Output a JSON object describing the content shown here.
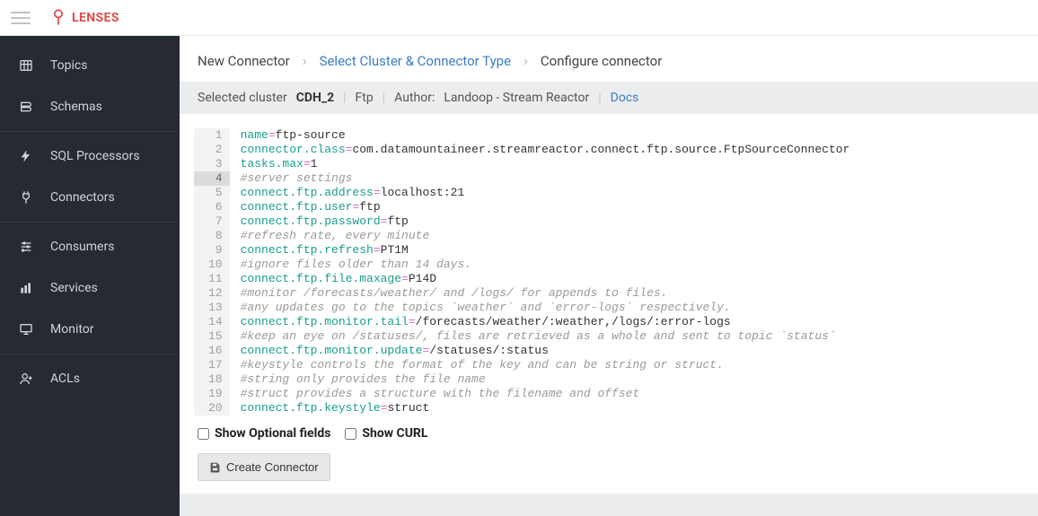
{
  "brand": {
    "name": "LENSES"
  },
  "sidebar": {
    "groups": [
      {
        "items": [
          {
            "icon": "table-icon",
            "label": "Topics"
          },
          {
            "icon": "layers-icon",
            "label": "Schemas"
          }
        ]
      },
      {
        "items": [
          {
            "icon": "bolt-icon",
            "label": "SQL Processors"
          },
          {
            "icon": "plug-icon",
            "label": "Connectors"
          }
        ]
      },
      {
        "items": [
          {
            "icon": "sliders-icon",
            "label": "Consumers"
          },
          {
            "icon": "barchart-icon",
            "label": "Services"
          },
          {
            "icon": "monitor-icon",
            "label": "Monitor"
          }
        ]
      },
      {
        "items": [
          {
            "icon": "useradd-icon",
            "label": "ACLs"
          }
        ]
      }
    ]
  },
  "breadcrumbs": {
    "items": [
      {
        "label": "New Connector",
        "link": false
      },
      {
        "label": "Select Cluster & Connector Type",
        "link": true
      },
      {
        "label": "Configure connector",
        "link": false
      }
    ]
  },
  "info": {
    "selected_cluster_label": "Selected cluster",
    "cluster": "CDH_2",
    "connector_type": "Ftp",
    "author_label": "Author:",
    "author": "Landoop - Stream Reactor",
    "docs": "Docs"
  },
  "editor": {
    "active_line": 4,
    "lines": [
      {
        "n": 1,
        "type": "kv",
        "key": "name",
        "value": "ftp-source"
      },
      {
        "n": 2,
        "type": "kv",
        "key": "connector.class",
        "value": "com.datamountaineer.streamreactor.connect.ftp.source.FtpSourceConnector"
      },
      {
        "n": 3,
        "type": "kv",
        "key": "tasks.max",
        "value": "1"
      },
      {
        "n": 4,
        "type": "comment",
        "text": "#server settings"
      },
      {
        "n": 5,
        "type": "kv",
        "key": "connect.ftp.address",
        "value": "localhost:21"
      },
      {
        "n": 6,
        "type": "kv",
        "key": "connect.ftp.user",
        "value": "ftp"
      },
      {
        "n": 7,
        "type": "kv",
        "key": "connect.ftp.password",
        "value": "ftp"
      },
      {
        "n": 8,
        "type": "comment",
        "text": "#refresh rate, every minute"
      },
      {
        "n": 9,
        "type": "kv",
        "key": "connect.ftp.refresh",
        "value": "PT1M"
      },
      {
        "n": 10,
        "type": "comment",
        "text": "#ignore files older than 14 days."
      },
      {
        "n": 11,
        "type": "kv",
        "key": "connect.ftp.file.maxage",
        "value": "P14D"
      },
      {
        "n": 12,
        "type": "comment",
        "text": "#monitor /forecasts/weather/ and /logs/ for appends to files."
      },
      {
        "n": 13,
        "type": "comment",
        "text": "#any updates go to the topics `weather` and `error-logs` respectively."
      },
      {
        "n": 14,
        "type": "kv",
        "key": "connect.ftp.monitor.tail",
        "value": "/forecasts/weather/:weather,/logs/:error-logs"
      },
      {
        "n": 15,
        "type": "comment",
        "text": "#keep an eye on /statuses/, files are retrieved as a whole and sent to topic `status`"
      },
      {
        "n": 16,
        "type": "kv",
        "key": "connect.ftp.monitor.update",
        "value": "/statuses/:status"
      },
      {
        "n": 17,
        "type": "comment",
        "text": "#keystyle controls the format of the key and can be string or struct."
      },
      {
        "n": 18,
        "type": "comment",
        "text": "#string only provides the file name"
      },
      {
        "n": 19,
        "type": "comment",
        "text": "#struct provides a structure with the filename and offset"
      },
      {
        "n": 20,
        "type": "kv",
        "key": "connect.ftp.keystyle",
        "value": "struct"
      }
    ]
  },
  "controls": {
    "optional_label": "Show Optional fields",
    "curl_label": "Show CURL"
  },
  "actions": {
    "create": "Create Connector"
  }
}
